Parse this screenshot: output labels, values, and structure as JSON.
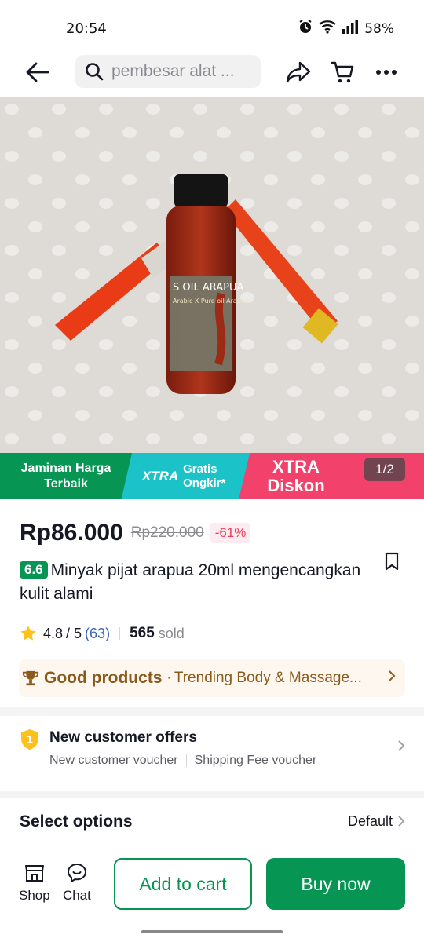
{
  "status_bar": {
    "time": "20:54",
    "battery": "58%"
  },
  "search": {
    "text": "pembesar alat ..."
  },
  "promo": {
    "guarantee": "Jaminan Harga Terbaik",
    "xtra_label": "XTRA",
    "free_shipping": "Gratis Ongkir*",
    "xtra_discount": "XTRA Diskon"
  },
  "image": {
    "page_indicator": "1/2",
    "bottle_label_line1": "S OIL ARAPUA",
    "bottle_label_line2": "Arabic X Pure oil Arapua"
  },
  "price": {
    "current": "Rp86.000",
    "original": "Rp220.000",
    "discount": "-61%"
  },
  "product": {
    "event_badge": "6.6",
    "title": "Minyak pijat arapua 20ml mengencangkan kulit alami"
  },
  "rating": {
    "score": "4.8",
    "out_of": "/ 5",
    "count": "(63)",
    "sold_number": "565",
    "sold_label": "sold"
  },
  "good_products": {
    "title": "Good products",
    "separator": "·",
    "subtitle": "Trending Body & Massage..."
  },
  "offers": {
    "title": "New customer offers",
    "badge": "1",
    "items": [
      "New customer voucher",
      "Shipping Fee voucher"
    ]
  },
  "options": {
    "label": "Select options",
    "value": "Default"
  },
  "bottom_bar": {
    "shop": "Shop",
    "chat": "Chat",
    "add_to_cart": "Add to cart",
    "buy_now": "Buy now"
  },
  "colors": {
    "brand_green": "#079554",
    "discount_red": "#f23b5b",
    "promo_teal": "#1bc3c8",
    "promo_pink": "#f2426b",
    "gold": "#8a5a1a"
  }
}
